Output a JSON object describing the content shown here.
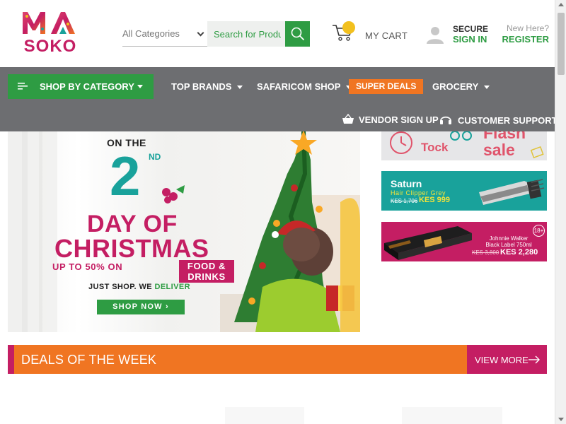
{
  "brand": {
    "logo_top": "MA",
    "logo_bottom": "SOKO",
    "colors": {
      "green": "#2e9c43",
      "magenta": "#c41e63",
      "orange": "#f07522",
      "teal": "#19a29b",
      "yellow": "#f2c01e",
      "nav_gray": "#6d6e71"
    }
  },
  "header": {
    "search": {
      "category_selected": "All Categories",
      "placeholder": "Search for Products",
      "button_icon": "search-icon"
    },
    "cart": {
      "label": "MY CART",
      "icon": "cart-icon"
    },
    "account": {
      "line1": "SECURE",
      "line2": "SIGN IN",
      "icon": "user-icon"
    },
    "register": {
      "line1": "New Here?",
      "line2": "REGISTER"
    }
  },
  "nav": {
    "shop_by_category": "SHOP BY CATEGORY",
    "items": [
      {
        "label": "TOP BRANDS"
      },
      {
        "label": "SAFARICOM SHOP"
      },
      {
        "label": "SUPER DEALS"
      },
      {
        "label": "GROCERY"
      }
    ],
    "vendor_signup": "VENDOR SIGN UP",
    "customer_support": "CUSTOMER SUPPORT"
  },
  "hero": {
    "on_the": "ON THE",
    "day_number": "2",
    "day_suffix": "ND",
    "day_of": "DAY OF",
    "christmas": "CHRISTMAS",
    "up_to": "UP TO 50% ON",
    "up_to_tag": "FOOD & DRINKS",
    "just": "JUST",
    "shop": "SHOP.",
    "we": "WE",
    "deliver": "DELIVER",
    "button": "SHOP NOW ›"
  },
  "side_banners": {
    "flash": {
      "tock": "Tock",
      "flash": "Flash",
      "sale": "sale"
    },
    "saturn": {
      "name": "Saturn",
      "desc": "Hair Clipper Grey",
      "old_price": "KES 1,706",
      "new_price": "KES 999"
    },
    "johnnie": {
      "name_line1": "Johnnie Walker",
      "name_line2": "Black Label 750ml",
      "old_price": "KES 3,800",
      "new_price": "KES 2,280",
      "age": "18+"
    }
  },
  "deals": {
    "title": "DEALS OF THE WEEK",
    "view_more": "VIEW MORE"
  }
}
